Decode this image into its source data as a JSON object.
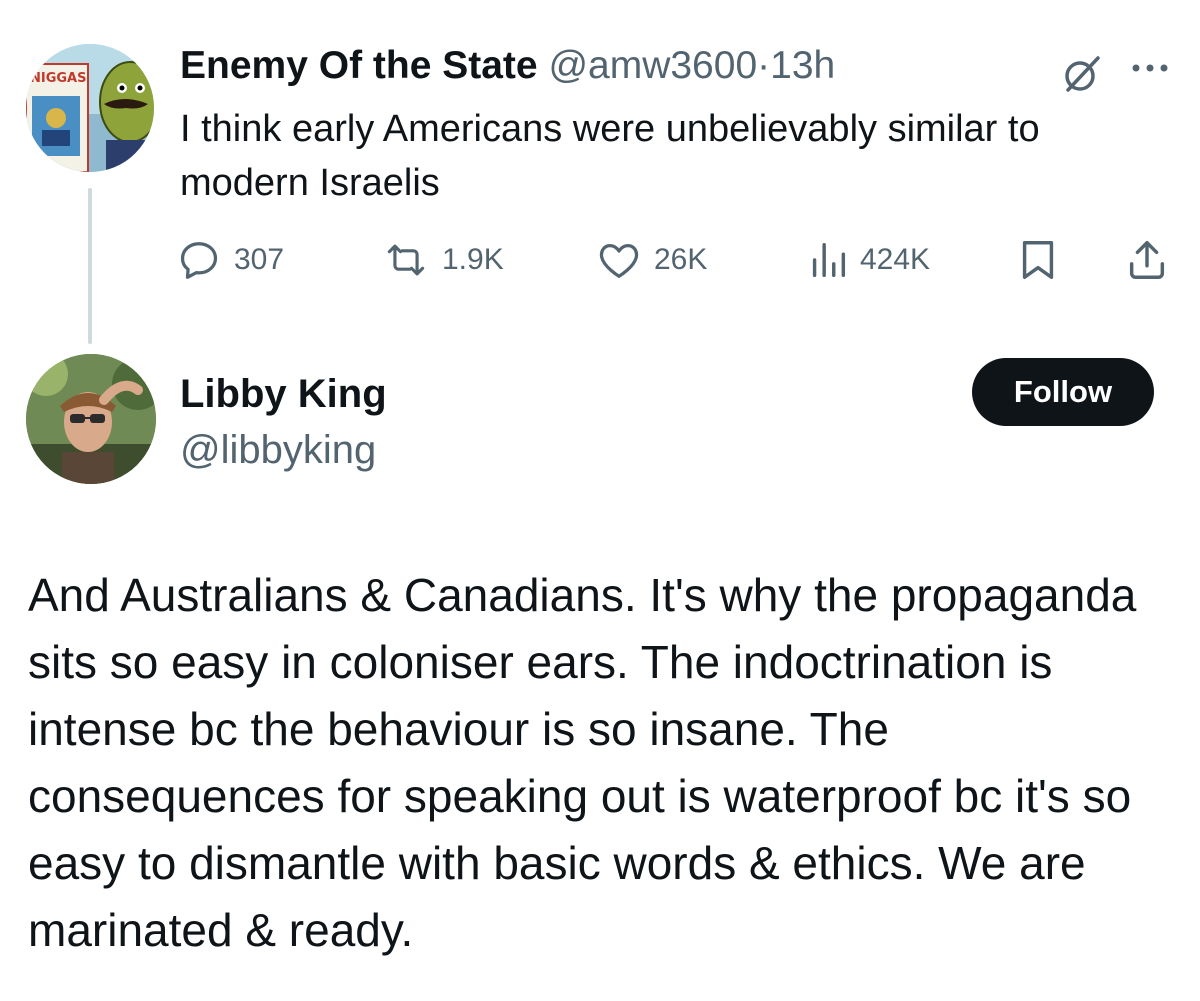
{
  "tweet1": {
    "author_name": "Enemy Of the State",
    "author_handle": "@amw3600",
    "separator": "·",
    "timestamp": "13h",
    "avatar_sign_text": "NIGGAS",
    "text": "I think early Americans were unbelievably similar to modern Israelis",
    "actions": {
      "replies": "307",
      "reposts": "1.9K",
      "likes": "26K",
      "views": "424K"
    }
  },
  "reply": {
    "author_name": "Libby King",
    "author_handle": "@libbyking",
    "follow_label": "Follow",
    "text": "And Australians & Canadians. It's why the propaganda sits so easy in coloniser ears. The indoctrination is intense bc the behaviour is so insane. The consequences for speaking out is waterproof bc it's so easy to dismantle with basic words & ethics. We are marinated & ready."
  },
  "colors": {
    "text_primary": "#0f1419",
    "text_secondary": "#536471",
    "follow_button_bg": "#0f1419",
    "thread_line": "#cfd9de"
  },
  "icons": [
    "grok-icon",
    "more-icon",
    "reply-icon",
    "repost-icon",
    "like-icon",
    "views-icon",
    "bookmark-icon",
    "share-icon"
  ]
}
